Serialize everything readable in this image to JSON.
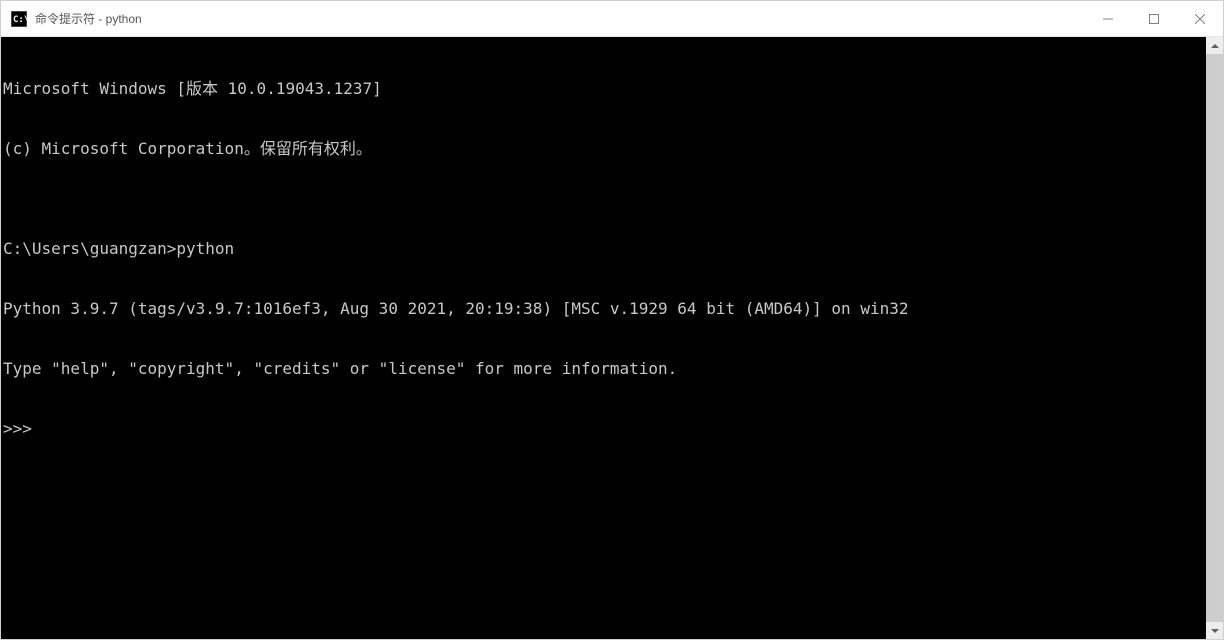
{
  "titlebar": {
    "title": "命令提示符 - python"
  },
  "terminal": {
    "lines": [
      "Microsoft Windows [版本 10.0.19043.1237]",
      "(c) Microsoft Corporation。保留所有权利。",
      "",
      "C:\\Users\\guangzan>python",
      "Python 3.9.7 (tags/v3.9.7:1016ef3, Aug 30 2021, 20:19:38) [MSC v.1929 64 bit (AMD64)] on win32",
      "Type \"help\", \"copyright\", \"credits\" or \"license\" for more information.",
      ">>>"
    ]
  }
}
